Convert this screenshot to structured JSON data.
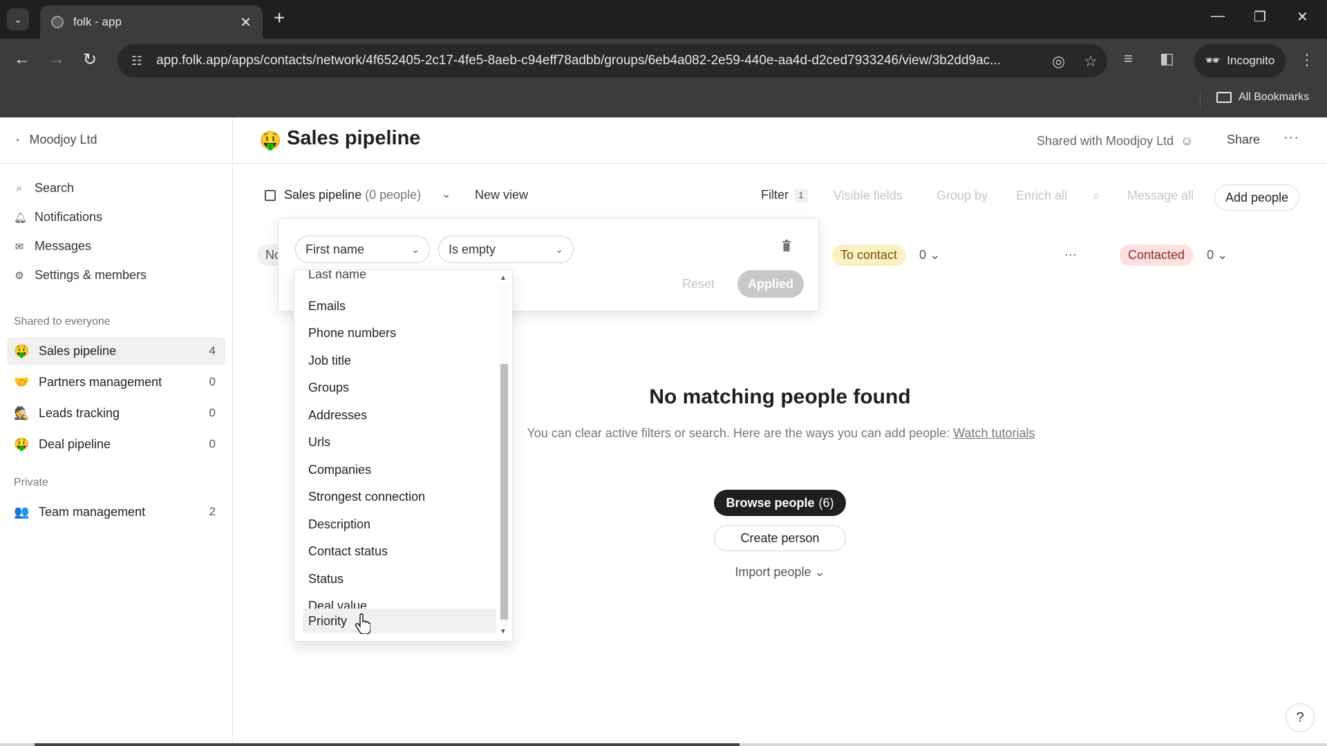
{
  "browser": {
    "tab_title": "folk - app",
    "url": "app.folk.app/apps/contacts/network/4f652405-2c17-4fe5-8aeb-c94eff78adbb/groups/6eb4a082-2e59-440e-aa4d-d2ced7933246/view/3b2dd9ac...",
    "incognito_label": "Incognito",
    "bookmarks_label": "All Bookmarks"
  },
  "sidebar": {
    "workspace": "Moodjoy Ltd",
    "nav": [
      {
        "label": "Search",
        "icon": "search-icon"
      },
      {
        "label": "Notifications",
        "icon": "bell-icon"
      },
      {
        "label": "Messages",
        "icon": "envelope-icon"
      },
      {
        "label": "Settings & members",
        "icon": "gear-icon"
      }
    ],
    "shared_label": "Shared to everyone",
    "shared_groups": [
      {
        "emoji": "🤑",
        "label": "Sales pipeline",
        "count": "4"
      },
      {
        "emoji": "🤝",
        "label": "Partners management",
        "count": "0"
      },
      {
        "emoji": "🕵",
        "label": "Leads tracking",
        "count": "0"
      },
      {
        "emoji": "🤑",
        "label": "Deal pipeline",
        "count": "0"
      }
    ],
    "private_label": "Private",
    "private_groups": [
      {
        "emoji": "👥",
        "label": "Team management",
        "count": "2"
      }
    ]
  },
  "header": {
    "emoji": "🤑",
    "title": "Sales pipeline",
    "shared_with": "Shared with Moodjoy Ltd",
    "share": "Share"
  },
  "viewbar": {
    "view_name": "Sales pipeline",
    "view_count": "(0 people)",
    "new_view": "New view",
    "filter": "Filter",
    "filter_count": "1",
    "visible_fields": "Visible fields",
    "group_by": "Group by",
    "enrich_all": "Enrich all",
    "message_all": "Message all",
    "add_people": "Add people"
  },
  "columns": {
    "first_partial": "No",
    "to_contact": "To contact",
    "to_contact_count": "0",
    "contacted": "Contacted",
    "contacted_count": "0"
  },
  "empty_state": {
    "title": "No matching people found",
    "description": "You can clear active filters or search. Here are the ways you can add people:",
    "link": "Watch tutorials",
    "browse": "Browse people",
    "browse_count": "(6)",
    "create": "Create person",
    "import": "Import people"
  },
  "filter_popover": {
    "field_value": "First name",
    "operator_value": "Is empty",
    "reset": "Reset",
    "applied": "Applied"
  },
  "field_dropdown": {
    "clipped_item": "Last name",
    "items": [
      "Emails",
      "Phone numbers",
      "Job title",
      "Groups",
      "Addresses",
      "Urls",
      "Companies",
      "Strongest connection",
      "Description",
      "Contact status",
      "Status",
      "Deal value",
      "Priority"
    ],
    "hovered_item": "Priority"
  },
  "help": "?"
}
